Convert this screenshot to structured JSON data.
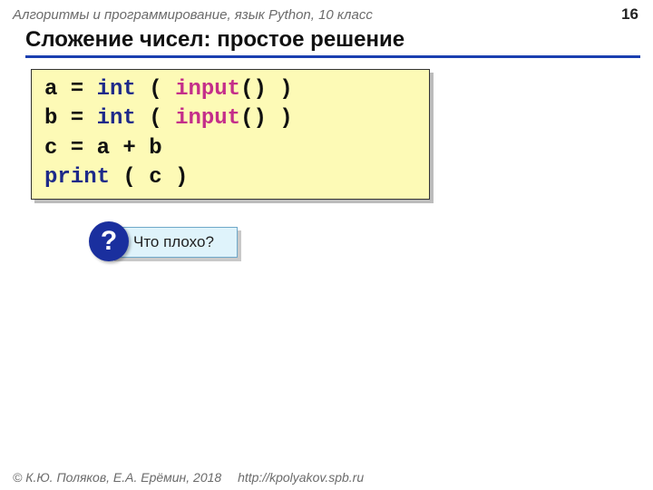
{
  "header": {
    "course_title": "Алгоритмы и программирование, язык Python, 10 класс",
    "page_number": "16"
  },
  "slide_title": "Сложение чисел: простое решение",
  "code": {
    "lines": [
      [
        {
          "t": "a",
          "c": "plain"
        },
        {
          "t": " = ",
          "c": "plain"
        },
        {
          "t": "int",
          "c": "key"
        },
        {
          "t": " ( ",
          "c": "plain"
        },
        {
          "t": "input",
          "c": "func"
        },
        {
          "t": "() )",
          "c": "plain"
        }
      ],
      [
        {
          "t": "b",
          "c": "plain"
        },
        {
          "t": " = ",
          "c": "plain"
        },
        {
          "t": "int",
          "c": "key"
        },
        {
          "t": " ( ",
          "c": "plain"
        },
        {
          "t": "input",
          "c": "func"
        },
        {
          "t": "() )",
          "c": "plain"
        }
      ],
      [
        {
          "t": "c",
          "c": "plain"
        },
        {
          "t": " = ",
          "c": "plain"
        },
        {
          "t": "a",
          "c": "plain"
        },
        {
          "t": " + ",
          "c": "plain"
        },
        {
          "t": "b",
          "c": "plain"
        }
      ],
      [
        {
          "t": "print",
          "c": "key"
        },
        {
          "t": " ( c )",
          "c": "plain"
        }
      ]
    ]
  },
  "callout": {
    "icon_char": "?",
    "text": "Что плохо?"
  },
  "footer": {
    "copyright": "© К.Ю. Поляков, Е.А. Ерёмин, 2018",
    "link": "http://kpolyakov.spb.ru"
  }
}
